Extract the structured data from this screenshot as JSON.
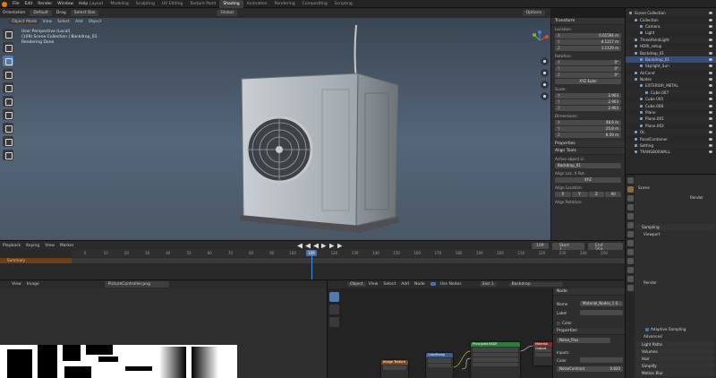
{
  "topbar": {
    "menu": [
      "File",
      "Edit",
      "Render",
      "Window",
      "Help"
    ],
    "workspaces": [
      "Layout",
      "Modeling",
      "Sculpting",
      "UV Editing",
      "Texture Paint",
      "Shading",
      "Animation",
      "Rendering",
      "Compositing",
      "Scripting"
    ],
    "active_workspace": "Shading"
  },
  "viewport": {
    "header": {
      "orientation_label": "Orientation",
      "orientation_value": "Default",
      "drag_label": "Drag",
      "drag_value": "Select Box",
      "transform_space": "Global",
      "options": "Options"
    },
    "sub_header": {
      "mode": "Object Mode",
      "menus": [
        "View",
        "Select",
        "Add",
        "Object"
      ]
    },
    "info_lines": [
      "User Perspective (Local)",
      "(109) Scene Collection | Backdrop_01",
      "Rendering Done"
    ]
  },
  "npanel": {
    "header": "Transform",
    "location_label": "Location:",
    "location": [
      [
        "X",
        "0.61594 m"
      ],
      [
        "Y",
        "-4.1217 m"
      ],
      [
        "Z",
        "1.1129 m"
      ]
    ],
    "rotation_label": "Rotation:",
    "rotation": [
      [
        "X",
        "0°"
      ],
      [
        "Y",
        "0°"
      ],
      [
        "Z",
        "0°"
      ]
    ],
    "rotation_mode": "XYZ Euler",
    "scale_label": "Scale:",
    "scale": [
      [
        "X",
        "2.903"
      ],
      [
        "Y",
        "2.903"
      ],
      [
        "Z",
        "2.903"
      ]
    ],
    "dimensions_label": "Dimensions:",
    "dimensions": [
      [
        "X",
        "48.6 m"
      ],
      [
        "Y",
        "25.8 m"
      ],
      [
        "Z",
        "8.59 m"
      ]
    ],
    "properties_header": "Properties",
    "align_header": "Align Tools",
    "active_object_label": "Active object is:",
    "active_object": "Backdrop_01",
    "align_axis_label": "Align Loc. X Rot.",
    "align_axis_value": "XYZ",
    "align_location_label": "Align Location:",
    "align_location_axes": [
      "X",
      "Y",
      "Z",
      "All"
    ],
    "align_rotation_label": "Align Rotation:"
  },
  "outliner": {
    "items": [
      {
        "name": "Scene Collection",
        "indent": 0,
        "sel": false
      },
      {
        "name": "Collection",
        "indent": 1,
        "sel": false
      },
      {
        "name": "Camera",
        "indent": 2,
        "sel": false
      },
      {
        "name": "Light",
        "indent": 2,
        "sel": false
      },
      {
        "name": "ThreePointLight",
        "indent": 1,
        "sel": false
      },
      {
        "name": "HDRI_setup",
        "indent": 1,
        "sel": false
      },
      {
        "name": "Backdrop_01",
        "indent": 1,
        "sel": false
      },
      {
        "name": "Backdrop_01",
        "indent": 2,
        "sel": true
      },
      {
        "name": "Skylight_Sun",
        "indent": 2,
        "sel": false
      },
      {
        "name": "AirCond",
        "indent": 1,
        "sel": false
      },
      {
        "name": "Nodes",
        "indent": 1,
        "sel": false
      },
      {
        "name": "EXTERIOR_METAL",
        "indent": 2,
        "sel": false
      },
      {
        "name": "Cube.007",
        "indent": 3,
        "sel": false
      },
      {
        "name": "Cube.005",
        "indent": 2,
        "sel": false
      },
      {
        "name": "Cube.008",
        "indent": 2,
        "sel": false
      },
      {
        "name": "Plane",
        "indent": 2,
        "sel": false
      },
      {
        "name": "Plane.001",
        "indent": 2,
        "sel": false
      },
      {
        "name": "Plane.002",
        "indent": 2,
        "sel": false
      },
      {
        "name": "OL",
        "indent": 1,
        "sel": false
      },
      {
        "name": "RoadContainer",
        "indent": 1,
        "sel": false
      },
      {
        "name": "Setting",
        "indent": 1,
        "sel": false
      },
      {
        "name": "TRANSBOXWALL",
        "indent": 1,
        "sel": false
      }
    ]
  },
  "properties": {
    "scene_label": "Scene",
    "render_label": "Render",
    "sampling": "Sampling",
    "viewport": "Viewport",
    "render": "Render",
    "adaptive_sampling": "Adaptive Sampling",
    "advanced": "Advanced",
    "light_paths": "Light Paths",
    "volumes": "Volumes",
    "hair": "Hair",
    "simplify": "Simplify",
    "motion_blur": "Motion Blur"
  },
  "timeline": {
    "menus": [
      "Playback",
      "Keying",
      "View",
      "Marker"
    ],
    "current_frame": "109",
    "start_label": "Start",
    "start": "1",
    "end_label": "End",
    "end": "250",
    "summary_label": "Summary",
    "ticks": [
      "0",
      "10",
      "20",
      "30",
      "40",
      "50",
      "60",
      "70",
      "80",
      "90",
      "100",
      "109",
      "120",
      "130",
      "140",
      "150",
      "160",
      "170",
      "180",
      "190",
      "200",
      "210",
      "220",
      "230",
      "240",
      "250"
    ]
  },
  "image_editor": {
    "menus": [
      "View",
      "Image"
    ],
    "image_name": "PictureController.png"
  },
  "node_editor": {
    "type": "Object",
    "menus": [
      "View",
      "Select",
      "Add",
      "Node"
    ],
    "use_nodes": "Use Nodes",
    "slot": "Slot 1",
    "material": "Backdrop",
    "nodes": [
      {
        "title": "Principled BSDF",
        "color": "#2f7a3d"
      },
      {
        "title": "Material Output",
        "color": "#7a2f2f"
      },
      {
        "title": "ColorRamp",
        "color": "#3a5d8a"
      },
      {
        "title": "Image Texture",
        "color": "#7a4a2a"
      }
    ],
    "side": {
      "node_header": "Node",
      "name_label": "Name",
      "name_value": "Material_Nodes_1.0...",
      "label_label": "Label",
      "color_label": "Color",
      "properties_header": "Properties",
      "noise_label": "Noise_Plus",
      "inputs_label": "Inputs:",
      "color_input_label": "Color",
      "noise_contrast_label": "NoiseContrast",
      "noise_contrast_value": "0.820"
    }
  },
  "colors": {
    "accent": "#4772b3",
    "active_tab": "#3d3d3d",
    "summary": "#6b4016"
  }
}
